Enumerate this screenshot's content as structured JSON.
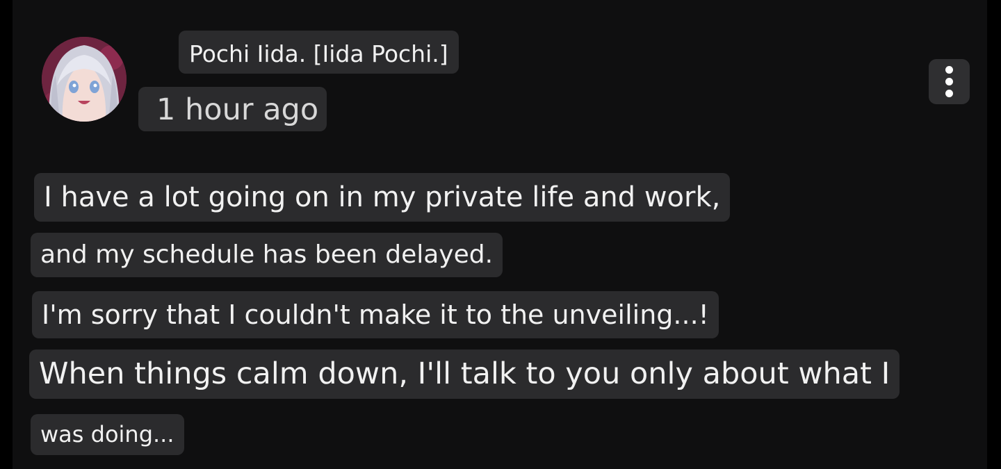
{
  "comment": {
    "author": "Pochi Iida. [Iida Pochi.]",
    "timestamp": "1 hour ago",
    "avatar_icon": "anime-avatar",
    "menu_icon": "more-vertical-icon",
    "lines": [
      "I have a lot going on in my private life and work,",
      "and my schedule has been delayed.",
      "I'm sorry that I couldn't make it to the unveiling...!",
      "When things calm down, I'll talk to you only about what I",
      "was doing..."
    ]
  },
  "colors": {
    "background": "#0f0f10",
    "chip": "#2b2b2d",
    "text": "#f1f1f1"
  }
}
